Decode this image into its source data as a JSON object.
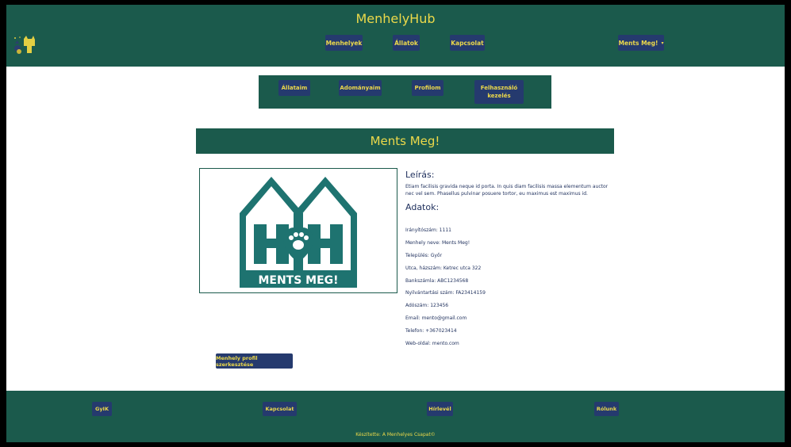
{
  "header": {
    "brand": "MenhelyHub",
    "nav": [
      {
        "label": "Menhelyek"
      },
      {
        "label": "Állatok"
      },
      {
        "label": "Kapcsolat"
      }
    ],
    "account_label": "Ments Meg!",
    "account_caret": "▾"
  },
  "subnav": [
    {
      "label": "Állataim"
    },
    {
      "label": "Adományaim"
    },
    {
      "label": "Profilom"
    },
    {
      "label": "Felhasználó kezelés"
    }
  ],
  "title": "Ments Meg!",
  "logo_text": "MENTS MEG!",
  "colors": {
    "primary": "#1b5a4c",
    "accent": "#ecd94a",
    "button": "#253a6e",
    "logo": "#1e7370"
  },
  "description": {
    "heading": "Leírás:",
    "text": "Etiam facilisis gravida neque id porta. In quis diam facilisis massa elementum auctor nec vel sem. Phasellus pulvinar posuere tortor, eu maximus est maximus id."
  },
  "data_heading": "Adatok:",
  "fields": [
    "Irányítószám: 1111",
    "Menhely neve: Ments Meg!",
    "Település: Győr",
    "Utca, házszám: Ketrec utca 322",
    "Bankszámla: ABC1234568",
    "Nyilvántartási szám: FA23414159",
    "Adószám: 123456",
    "Email: mento@gmail.com",
    "Telefon: +367023414",
    "Web-oldal: mento.com"
  ],
  "edit_button": "Menhely profil szerkesztése",
  "footer": {
    "links": [
      {
        "label": "GyIK"
      },
      {
        "label": "Kapcsolat"
      },
      {
        "label": "Hírlevél"
      },
      {
        "label": "Rólunk"
      }
    ],
    "copyright": "Készítette: A Menhelyes Csapat©"
  }
}
